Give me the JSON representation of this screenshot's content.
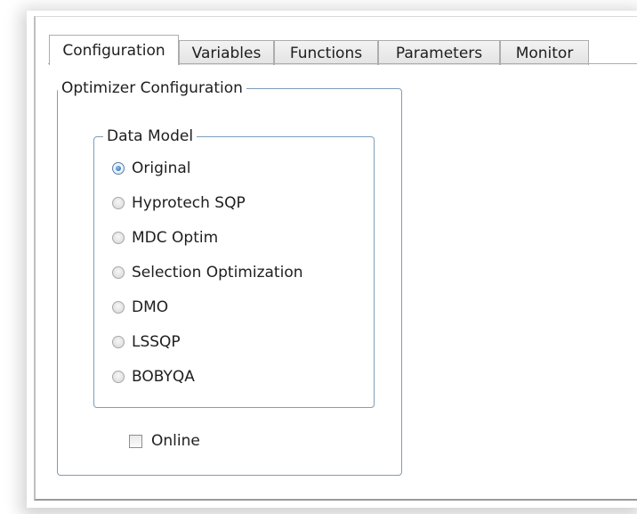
{
  "tabs": [
    {
      "label": "Configuration",
      "active": true
    },
    {
      "label": "Variables",
      "active": false
    },
    {
      "label": "Functions",
      "active": false
    },
    {
      "label": "Parameters",
      "active": false
    },
    {
      "label": "Monitor",
      "active": false
    }
  ],
  "optimizer_group": {
    "title": "Optimizer Configuration"
  },
  "data_model_group": {
    "title": "Data Model",
    "selected": "Original",
    "options": [
      {
        "label": "Original",
        "checked": true
      },
      {
        "label": "Hyprotech SQP",
        "checked": false
      },
      {
        "label": "MDC Optim",
        "checked": false
      },
      {
        "label": "Selection Optimization",
        "checked": false
      },
      {
        "label": "DMO",
        "checked": false
      },
      {
        "label": "LSSQP",
        "checked": false
      },
      {
        "label": "BOBYQA",
        "checked": false
      }
    ]
  },
  "online_checkbox": {
    "label": "Online",
    "checked": false
  }
}
